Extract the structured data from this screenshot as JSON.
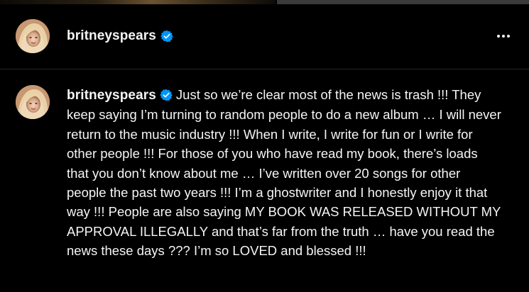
{
  "post": {
    "username": "britneyspears",
    "verified": true,
    "caption": "Just so we’re clear most of the news is trash !!! They keep saying I’m turning to random people to do a new album … I will never return to the music industry !!! When I write, I write for fun or I write for other people !!! For those of you who have read my book, there’s loads that you don’t know about me … I’ve written over 20 songs for other people the past two years !!! I’m a ghostwriter and I honestly enjoy it that way !!! People are also saying MY BOOK WAS RELEASED WITHOUT MY APPROVAL ILLEGALLY and that’s far from the truth … have you read the news these days ??? I’m so LOVED and blessed !!!"
  },
  "colors": {
    "background": "#000000",
    "text": "#f5f5f5",
    "verified_badge": "#0095f6",
    "divider": "#262626"
  },
  "icons": {
    "verified": "verified-badge-icon",
    "more": "more-options-icon"
  }
}
